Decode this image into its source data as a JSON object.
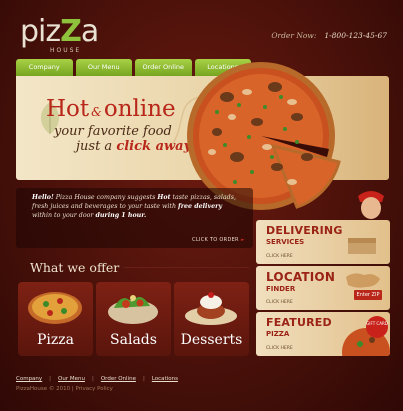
{
  "logo": {
    "text_a": "piz",
    "text_z": "Z",
    "text_b": "a",
    "sub": "HOUSE"
  },
  "order": {
    "label": "Order Now:",
    "phone": "1-800-123-45-67"
  },
  "nav": [
    "Company",
    "Our Menu",
    "Order Online",
    "Locations"
  ],
  "hero": {
    "title_a": "Hot",
    "amp": "&",
    "title_b": "online",
    "line1": "your favorite food",
    "line2_a": "just a",
    "line2_b": "click away"
  },
  "hello": {
    "p1": "Hello!",
    "p2": " Pizza House company suggests ",
    "p3": "Hot",
    "p4": " taste pizzas, salads, fresh juices and beverages to your taste with ",
    "p5": "free delivery",
    "p6": " within to your door ",
    "p7": "during 1 hour.",
    "cta": "CLICK TO ORDER"
  },
  "offer": {
    "title": "What we offer",
    "items": [
      "Pizza",
      "Salads",
      "Desserts"
    ]
  },
  "panels": {
    "delivering": {
      "title": "DELIVERING",
      "sub": "SERVICES",
      "click": "CLICK HERE"
    },
    "location": {
      "title": "LOCATION",
      "sub": "FINDER",
      "click": "CLICK HERE",
      "zip": "Enter ZIP"
    },
    "featured": {
      "title": "FEATURED",
      "sub": "PIZZA",
      "click": "CLICK HERE",
      "badge": "GIFT CARD"
    }
  },
  "footer": {
    "links": [
      "Company",
      "Our Menu",
      "Order Online",
      "Locations"
    ],
    "copyright": "PizzaHouse © 2010  |  Privacy Policy"
  },
  "colors": {
    "accent_green": "#8fc23c",
    "accent_red": "#b8271a",
    "bg_dark": "#3a0c08"
  }
}
